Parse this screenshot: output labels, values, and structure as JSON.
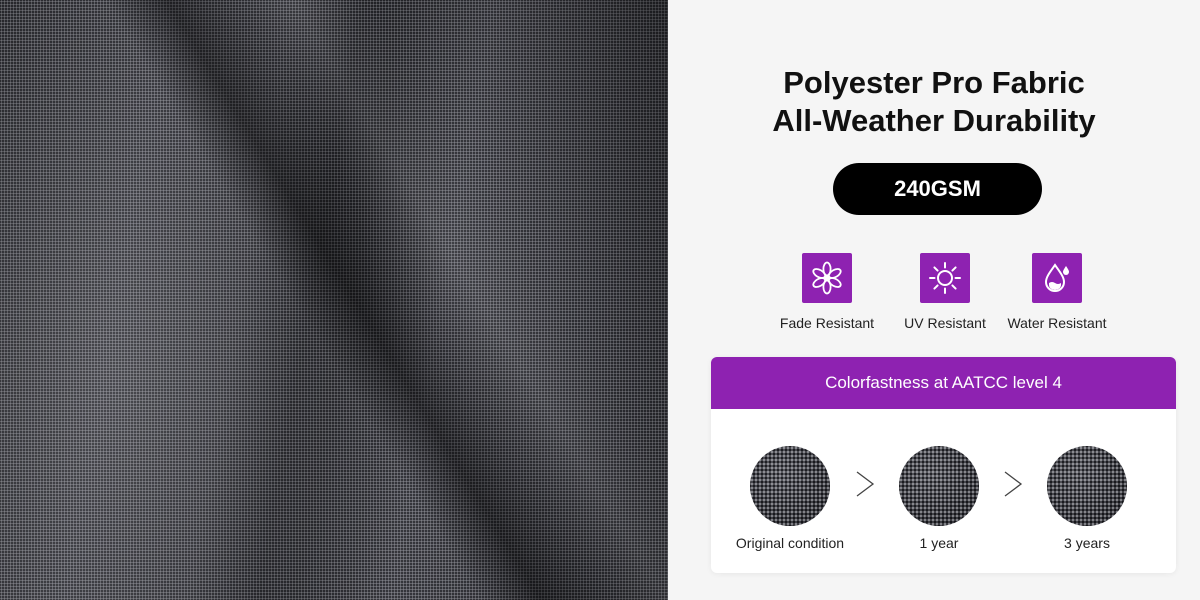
{
  "headline": {
    "line1": "Polyester Pro Fabric",
    "line2": "All-Weather Durability"
  },
  "weight_badge": "240GSM",
  "features": [
    {
      "icon": "flower-icon",
      "label": "Fade Resistant"
    },
    {
      "icon": "sun-icon",
      "label": "UV Resistant"
    },
    {
      "icon": "water-drop-icon",
      "label": "Water Resistant"
    }
  ],
  "colorfastness": {
    "title": "Colorfastness at AATCC level 4",
    "stages": [
      {
        "label": "Original condition"
      },
      {
        "label": "1 year"
      },
      {
        "label": "3 years"
      }
    ]
  },
  "colors": {
    "accent": "#8e22b1",
    "badge_bg": "#000000",
    "panel_bg": "#f5f5f5"
  }
}
